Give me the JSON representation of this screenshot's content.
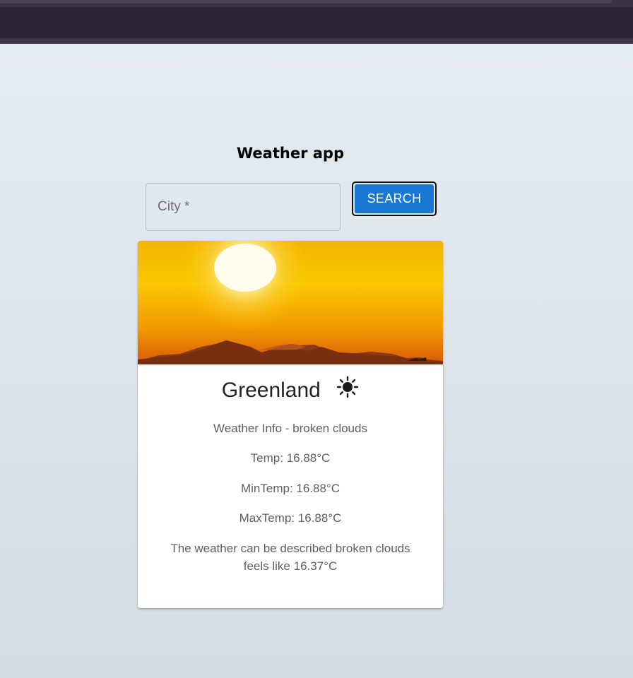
{
  "app": {
    "title": "Weather app"
  },
  "search": {
    "placeholder": "City *",
    "value": "",
    "button_label": "SEARCH"
  },
  "weather": {
    "city": "Greenland",
    "icon": "sun-icon",
    "info": "Weather Info - broken clouds",
    "temp": "Temp: 16.88°C",
    "min_temp": "MinTemp: 16.88°C",
    "max_temp": "MaxTemp: 16.88°C",
    "description_line1": "The weather can be described broken clouds",
    "description_line2": "feels like 16.37°C"
  },
  "colors": {
    "accent": "#1976d2",
    "browser_bar": "#2d2438",
    "page_bg_top": "#e4ebf1",
    "page_bg_bottom": "#d4dce3"
  }
}
